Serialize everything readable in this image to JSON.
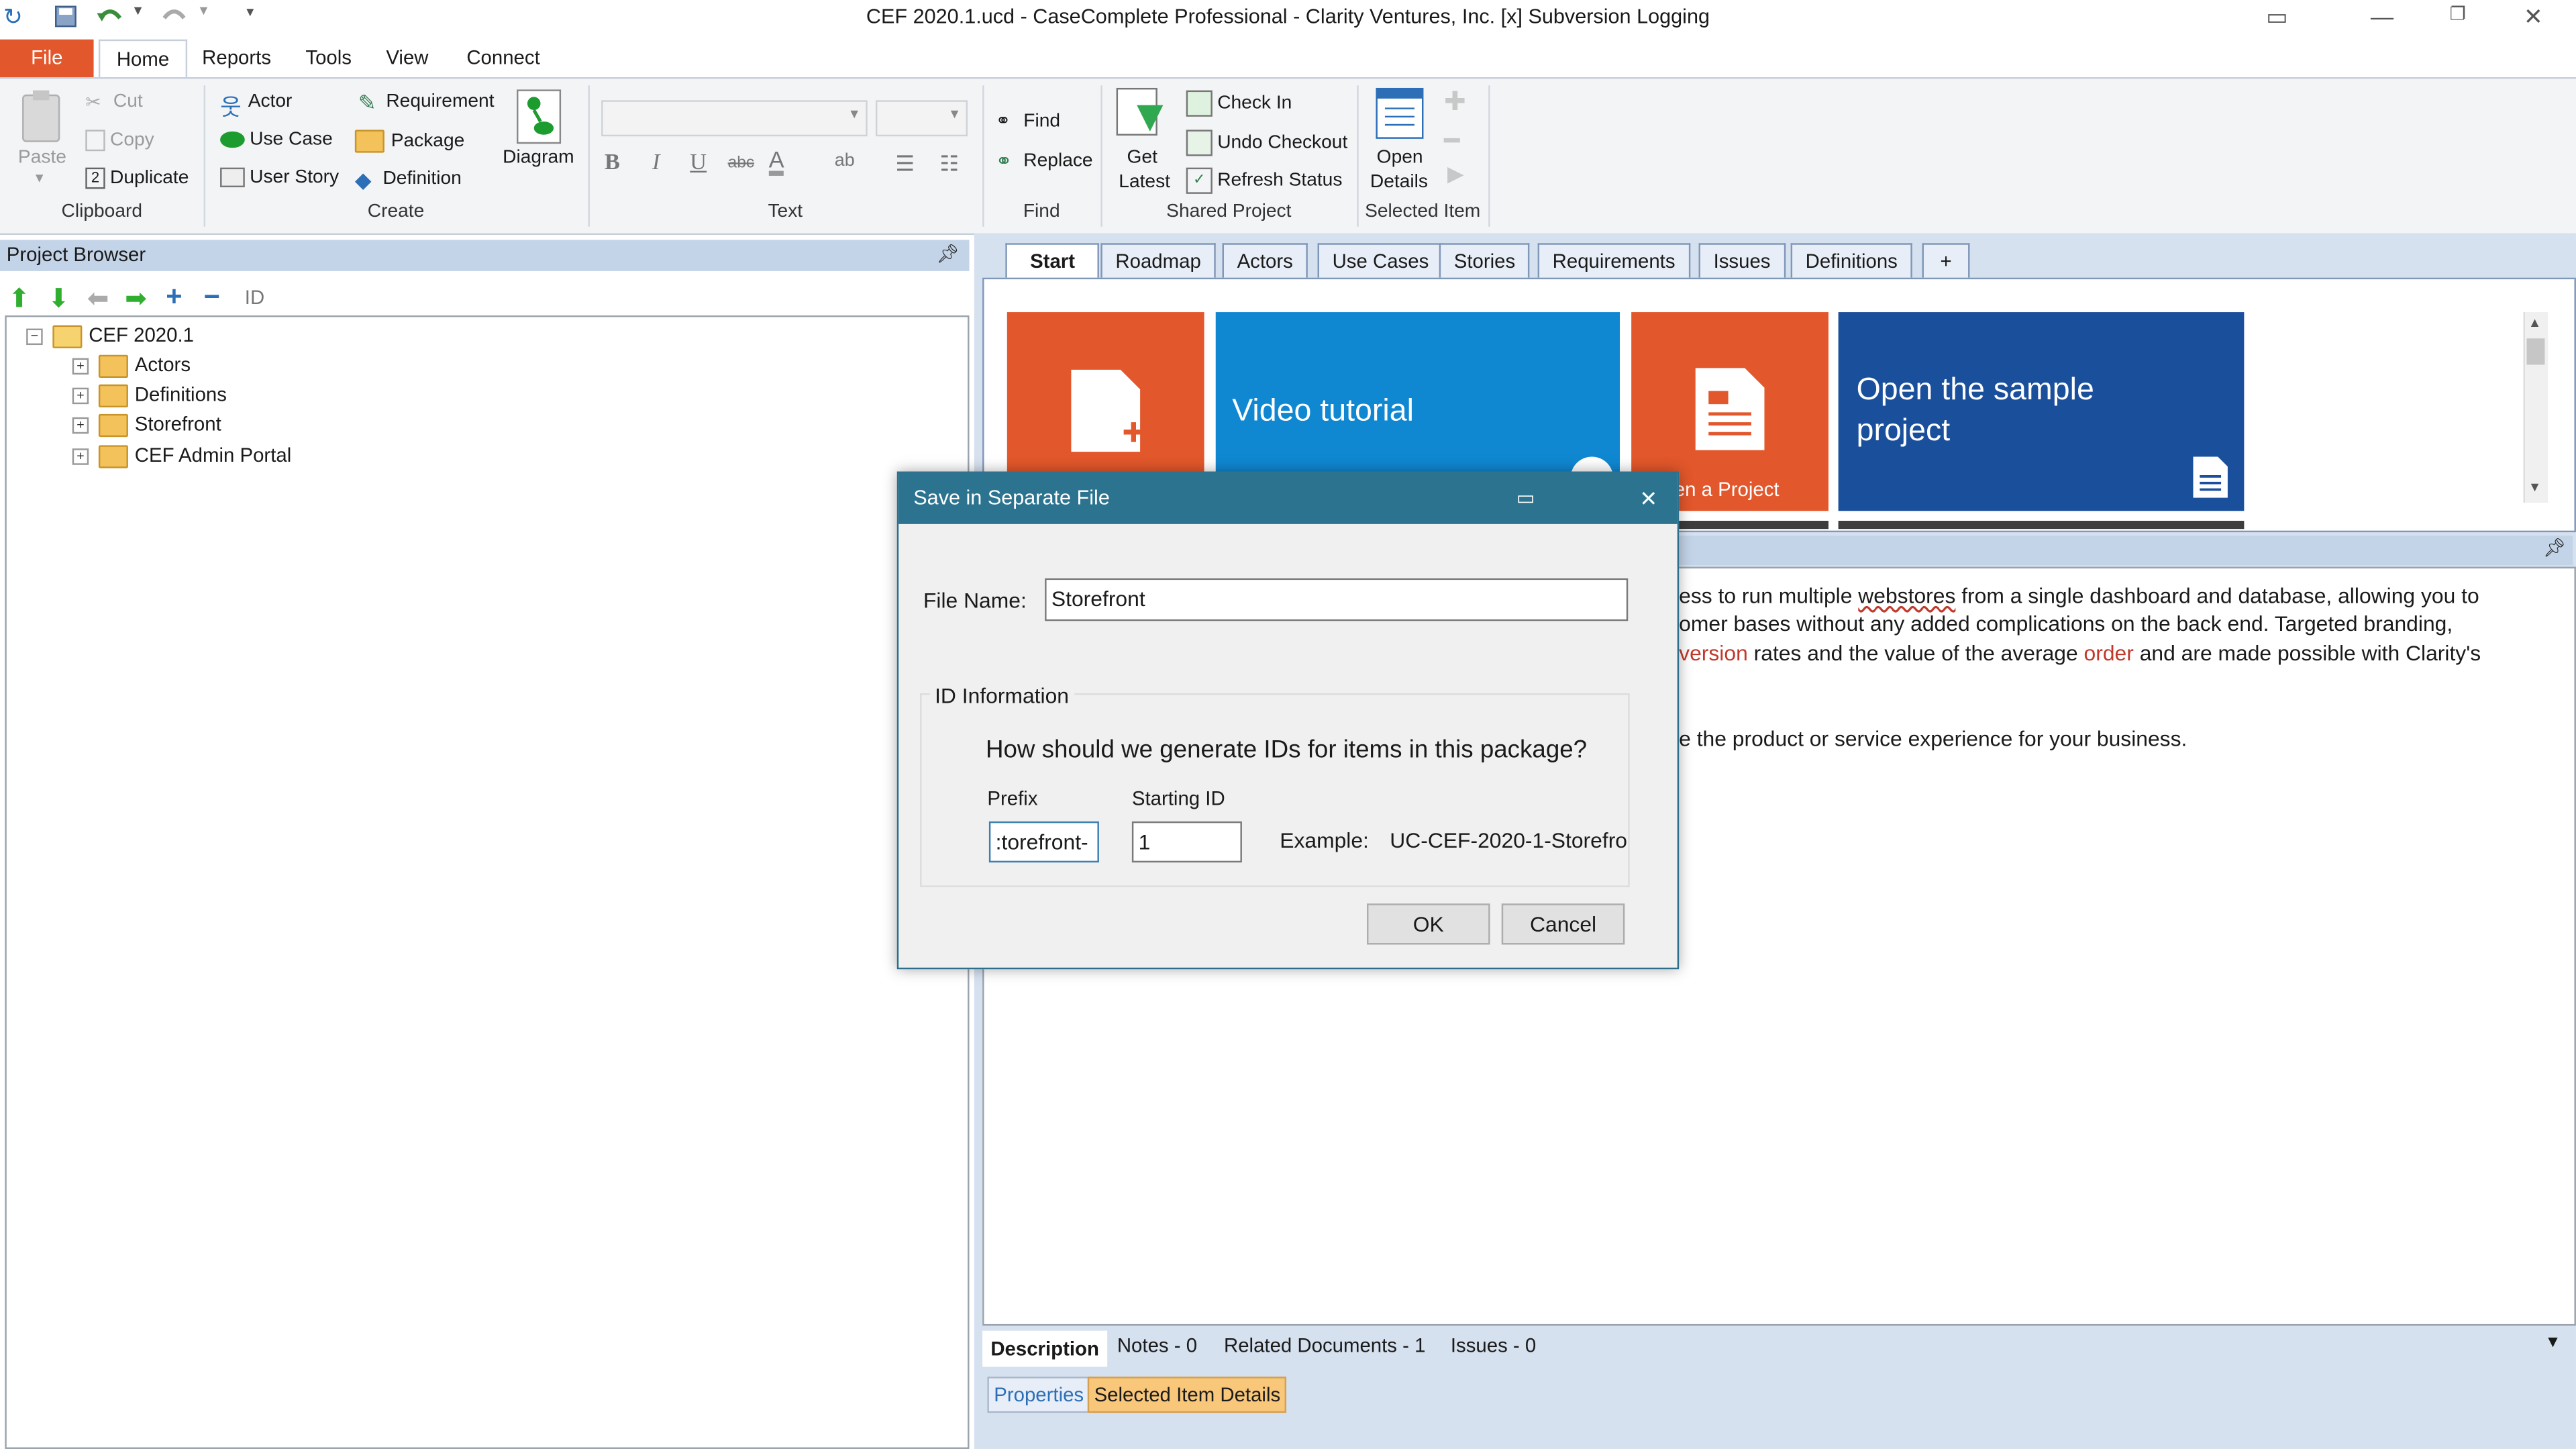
{
  "window": {
    "title": "CEF 2020.1.ucd - CaseComplete Professional - Clarity Ventures, Inc. [x] Subversion Logging"
  },
  "menu": {
    "file": "File",
    "tabs": [
      "Home",
      "Reports",
      "Tools",
      "View",
      "Connect"
    ]
  },
  "ribbon": {
    "clipboard": {
      "paste": "Paste",
      "cut": "Cut",
      "copy": "Copy",
      "duplicate": "Duplicate",
      "label": "Clipboard"
    },
    "create": {
      "actor": "Actor",
      "use_case": "Use Case",
      "user_story": "User Story",
      "requirement": "Requirement",
      "package": "Package",
      "definition": "Definition",
      "diagram": "Diagram",
      "label": "Create"
    },
    "text": {
      "label": "Text",
      "bold": "B",
      "italic": "I",
      "underline": "U",
      "strike": "abc"
    },
    "find": {
      "find": "Find",
      "replace": "Replace",
      "label": "Find"
    },
    "shared": {
      "get": "Get",
      "latest": "Latest",
      "check_in": "Check In",
      "undo_checkout": "Undo Checkout",
      "refresh": "Refresh Status",
      "label": "Shared Project"
    },
    "selected": {
      "open": "Open",
      "details": "Details",
      "label": "Selected Item"
    }
  },
  "project_browser": {
    "title": "Project Browser",
    "toolbar_id": "ID",
    "root": "CEF 2020.1",
    "nodes": [
      "Actors",
      "Definitions",
      "Storefront",
      "CEF Admin Portal"
    ]
  },
  "content_tabs": [
    "Start",
    "Roadmap",
    "Actors",
    "Use Cases",
    "Stories",
    "Requirements",
    "Issues",
    "Definitions",
    "+"
  ],
  "tiles": {
    "video": "Video tutorial",
    "open_project": "en a Project",
    "sample_line1": "Open the sample",
    "sample_line2": "project"
  },
  "description": {
    "line1_a": "ess to run multiple ",
    "line1_b": "webstores",
    "line1_c": " from a single dashboard and database, allowing you to",
    "line2": "omer bases without any added complications on the back end. Targeted branding,",
    "line3_a": "version",
    "line3_b": " rates and the value of the average ",
    "line3_c": "order",
    "line3_d": " and are made possible with Clarity's",
    "line4": "e the product or service experience for your business."
  },
  "bottom_tabs": [
    "Description",
    "Notes - 0",
    "Related Documents - 1",
    "Issues - 0"
  ],
  "props_tabs": [
    "Properties",
    "Selected Item Details"
  ],
  "dialog": {
    "title": "Save in Separate File",
    "file_name_label": "File Name:",
    "file_name_value": "Storefront",
    "id_group": "ID Information",
    "question": "How should we generate IDs for items in this package?",
    "prefix_label": "Prefix",
    "prefix_value": ":torefront-",
    "starting_label": "Starting ID",
    "starting_value": "1",
    "example_label": "Example:",
    "example_value": "UC-CEF-2020-1-Storefro",
    "ok": "OK",
    "cancel": "Cancel"
  },
  "colors": {
    "accent_orange": "#e2572b",
    "tile_blue": "#0f87d1",
    "tile_navy": "#1a4f9c",
    "dialog_title": "#2c7390"
  }
}
